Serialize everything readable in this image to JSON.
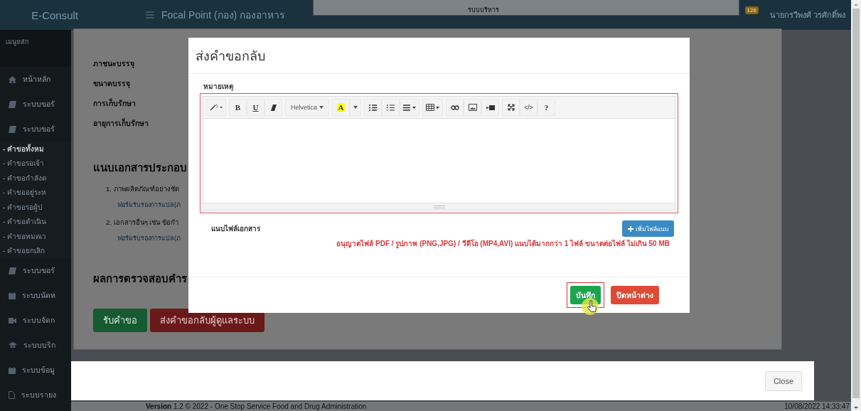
{
  "topbar": {
    "brand": "E-Consult",
    "title": "Focal Point (กอง) กองอาหาร",
    "notification_count": "126",
    "user": "นายกรวีพงศ์ วรศักดิ์พง"
  },
  "header_field": "รบบบริหาร",
  "sidebar": {
    "header": "เมนูหลัก",
    "items": [
      {
        "label": "หน้าหลัก",
        "kind": "home"
      },
      {
        "label": "ระบบขอรั",
        "kind": "book"
      },
      {
        "label": "ระบบขอรั",
        "kind": "book"
      },
      {
        "label": "- คำขอทั้งหม",
        "kind": "sub",
        "selected": true
      },
      {
        "label": "- คำขอรอเจ้า",
        "kind": "sub",
        "selected": false
      },
      {
        "label": "- คำขอกำลังด",
        "kind": "sub",
        "selected": false
      },
      {
        "label": "- คำขออยู่ระห",
        "kind": "sub",
        "selected": false
      },
      {
        "label": "- คำขอรอผู้ป",
        "kind": "sub",
        "selected": false
      },
      {
        "label": "- คำขอดำเนิน",
        "kind": "sub",
        "selected": false
      },
      {
        "label": "- คำขอหมดเว",
        "kind": "sub",
        "selected": false
      },
      {
        "label": "- คำขอยกเลิก",
        "kind": "sub",
        "selected": false
      },
      {
        "label": "ระบบขอรั",
        "kind": "book"
      },
      {
        "label": "ระบบนัดห",
        "kind": "calendar"
      },
      {
        "label": "ระบบจัดก",
        "kind": "camera"
      },
      {
        "label": "ระบบบริก",
        "kind": "cap"
      },
      {
        "label": "ระบบข้อมู",
        "kind": "calendar"
      },
      {
        "label": "ระบบรายง",
        "kind": "file"
      }
    ]
  },
  "request_form": {
    "fields": [
      "ภาชนะบรรจุ",
      "ขนาดบรรจุ",
      "การเก็บรักษา",
      "อายุการเก็บรักษา"
    ],
    "attachments_heading": "แนบเอกสารประกอบ",
    "attachments": [
      {
        "text": "1. ภาพผลิตภัณฑ์อย่างชัด",
        "link": "ฟอร์มรับรองการแปล(ภ"
      },
      {
        "text": "2. เอกสารอื่นๆ เช่น ข้อกำ",
        "link": "ฟอร์มรับรองการแปล(ภ"
      }
    ],
    "result_heading": "ผลการตรวจสอบคำร",
    "buttons": [
      {
        "label": "รับคำขอ",
        "kind": "accept"
      },
      {
        "label": "ส่งคำขอกลับผู้ดูแลระบบ",
        "kind": "return"
      }
    ],
    "close_button": "Close"
  },
  "footer": {
    "version": "**Version** 1.2 © 2022 - One Stop Service Food and Drug Administration",
    "datetime": "10/08/2022 14:33:47"
  },
  "dialog": {
    "title": "ส่งคำขอกลับ",
    "note_label": "หมายเหตุ",
    "toolbar": {
      "bold": "B",
      "underline": "U",
      "font": "Helvetica",
      "text_color_button": "A",
      "code": "</>",
      "help": "?"
    },
    "attach_label": "แนบไฟล์เอกสาร",
    "add_file_button": "เพิ่มไฟล์แนบ",
    "file_rule": "อนุญาตไฟล์ PDF / รูปภาพ (PNG,JPG) / วีดีโอ (MP4,AVI) แนบได้มากกว่า 1 ไฟล์ ขนาดต่อไฟล์ ไม่เกิน 50 MB",
    "buttons": [
      {
        "label": "บันทึก",
        "kind": "save",
        "highlighted": true
      },
      {
        "label": "ปิดหน้าต่าง",
        "kind": "close",
        "highlighted": false
      }
    ]
  }
}
